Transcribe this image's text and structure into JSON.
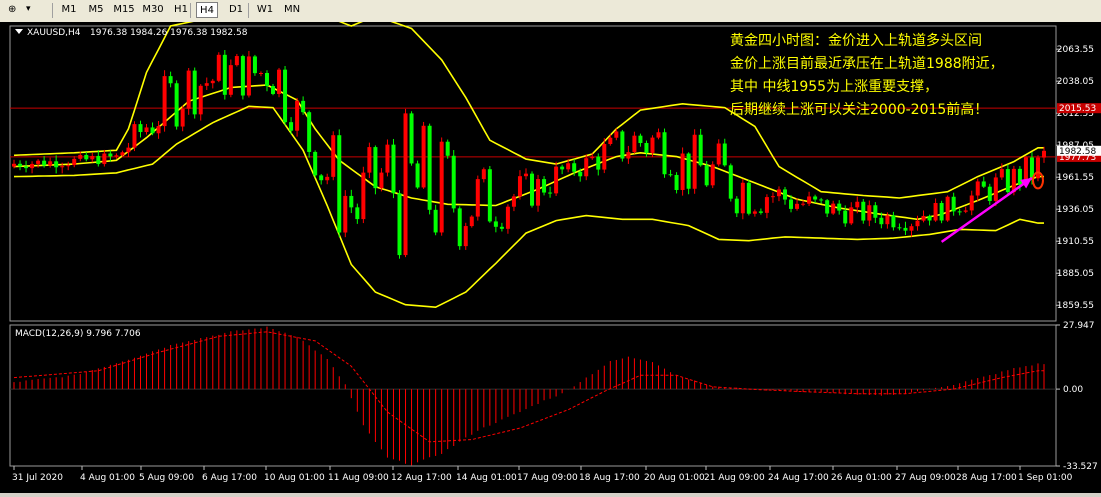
{
  "toolbar": {
    "timeframes": [
      "M1",
      "M5",
      "M15",
      "M30",
      "H1",
      "H4",
      "D1",
      "W1",
      "MN"
    ],
    "active": "H4"
  },
  "chart_data": {
    "type": "candlestick",
    "symbol_label": "XAUUSD,H4",
    "ohlc_label": "1976.38 1984.26 1976.38 1982.58",
    "price_axis": {
      "ylim": [
        1847,
        2082
      ],
      "ticks": [
        "2063.55",
        "2038.05",
        "2012.55",
        "1987.05",
        "1961.55",
        "1936.05",
        "1910.55",
        "1885.05",
        "1859.55"
      ]
    },
    "horizontal_lines": [
      {
        "price": 2016.53,
        "label": "2015.53",
        "color": "#c80000"
      },
      {
        "price": 1977.73,
        "label": "1977.73",
        "color": "#c80000"
      }
    ],
    "last_price": {
      "price": 1982.58,
      "label": "1982.58"
    },
    "time_labels": [
      "31 Jul 2020",
      "4 Aug 01:00",
      "5 Aug 09:00",
      "6 Aug 17:00",
      "10 Aug 01:00",
      "11 Aug 09:00",
      "12 Aug 17:00",
      "14 Aug 01:00",
      "17 Aug 09:00",
      "18 Aug 17:00",
      "20 Aug 01:00",
      "21 Aug 09:00",
      "24 Aug 17:00",
      "26 Aug 01:00",
      "27 Aug 09:00",
      "28 Aug 17:00",
      "1 Sep 01:00"
    ],
    "bar_count": 172,
    "bb_upper": [
      [
        0,
        1979
      ],
      [
        10,
        1981
      ],
      [
        17,
        1983
      ],
      [
        19,
        2000
      ],
      [
        22,
        2045
      ],
      [
        26,
        2082
      ],
      [
        32,
        2088
      ],
      [
        40,
        2093
      ],
      [
        50,
        2093
      ],
      [
        56,
        2082
      ],
      [
        60,
        2090
      ],
      [
        66,
        2080
      ],
      [
        71,
        2055
      ],
      [
        75,
        2025
      ],
      [
        79,
        1991
      ],
      [
        85,
        1976
      ],
      [
        90,
        1972
      ],
      [
        96,
        1980
      ],
      [
        100,
        2000
      ],
      [
        104,
        2015
      ],
      [
        111,
        2020
      ],
      [
        118,
        2017
      ],
      [
        123,
        2002
      ],
      [
        127,
        1970
      ],
      [
        134,
        1950
      ],
      [
        141,
        1947
      ],
      [
        147,
        1945
      ],
      [
        155,
        1950
      ],
      [
        160,
        1962
      ],
      [
        166,
        1974
      ],
      [
        170,
        1985
      ]
    ],
    "bb_middle": [
      [
        0,
        1970
      ],
      [
        10,
        1972
      ],
      [
        17,
        1975
      ],
      [
        22,
        1993
      ],
      [
        29,
        2022
      ],
      [
        36,
        2033
      ],
      [
        42,
        2035
      ],
      [
        47,
        2023
      ],
      [
        50,
        2000
      ],
      [
        54,
        1975
      ],
      [
        60,
        1954
      ],
      [
        66,
        1945
      ],
      [
        72,
        1940
      ],
      [
        80,
        1939
      ],
      [
        87,
        1952
      ],
      [
        93,
        1965
      ],
      [
        100,
        1978
      ],
      [
        104,
        1981
      ],
      [
        110,
        1978
      ],
      [
        116,
        1970
      ],
      [
        123,
        1957
      ],
      [
        130,
        1944
      ],
      [
        137,
        1937
      ],
      [
        144,
        1932
      ],
      [
        150,
        1928
      ],
      [
        154,
        1932
      ],
      [
        160,
        1943
      ],
      [
        166,
        1955
      ],
      [
        170,
        1962
      ]
    ],
    "bb_lower": [
      [
        0,
        1962
      ],
      [
        10,
        1963
      ],
      [
        17,
        1965
      ],
      [
        23,
        1972
      ],
      [
        27,
        1988
      ],
      [
        33,
        2005
      ],
      [
        39,
        2018
      ],
      [
        43,
        2017
      ],
      [
        48,
        1983
      ],
      [
        52,
        1939
      ],
      [
        56,
        1892
      ],
      [
        60,
        1870
      ],
      [
        65,
        1860
      ],
      [
        70,
        1858
      ],
      [
        75,
        1870
      ],
      [
        80,
        1893
      ],
      [
        85,
        1917
      ],
      [
        90,
        1927
      ],
      [
        95,
        1931
      ],
      [
        101,
        1928
      ],
      [
        106,
        1928
      ],
      [
        112,
        1923
      ],
      [
        117,
        1912
      ],
      [
        122,
        1911
      ],
      [
        128,
        1914
      ],
      [
        134,
        1913
      ],
      [
        140,
        1912
      ],
      [
        146,
        1913
      ],
      [
        152,
        1916
      ],
      [
        157,
        1920
      ],
      [
        163,
        1919
      ],
      [
        167,
        1928
      ],
      [
        170,
        1925
      ]
    ],
    "annotation": {
      "lines": [
        "黄金四小时图：金价进入上轨道多头区间",
        "金价上涨目前最近承压在上轨道1988附近，",
        "其中 中线1955为上涨重要支撑，",
        "后期继续上涨可以关注2000-2015前高！"
      ],
      "color": "#ffff00"
    },
    "arrow": {
      "from": [
        154,
        1910
      ],
      "to": [
        170,
        1961
      ],
      "color": "#ff00ff"
    },
    "circle_marker": {
      "x": 170,
      "price": 1959,
      "color": "#ff3300"
    },
    "macd": {
      "label": "MACD(12,26,9) 9.796 7.706",
      "ylim": [
        -33.527,
        27.947
      ],
      "ticks": [
        "27.947",
        "0.00",
        "-33.527"
      ],
      "histogram_points": [
        [
          0,
          3
        ],
        [
          10,
          6
        ],
        [
          19,
          13
        ],
        [
          27,
          20
        ],
        [
          36,
          25
        ],
        [
          42,
          27
        ],
        [
          47,
          23
        ],
        [
          52,
          13
        ],
        [
          55,
          2
        ],
        [
          58,
          -16
        ],
        [
          62,
          -30
        ],
        [
          66,
          -33
        ],
        [
          71,
          -28
        ],
        [
          77,
          -18
        ],
        [
          84,
          -10
        ],
        [
          88,
          -5
        ],
        [
          91,
          -2
        ],
        [
          95,
          5
        ],
        [
          99,
          12
        ],
        [
          102,
          14
        ],
        [
          106,
          12
        ],
        [
          110,
          6
        ],
        [
          116,
          1
        ],
        [
          122,
          0
        ],
        [
          130,
          -1
        ],
        [
          138,
          -2
        ],
        [
          144,
          -3
        ],
        [
          150,
          -1
        ],
        [
          156,
          2
        ],
        [
          162,
          6
        ],
        [
          166,
          9
        ],
        [
          170,
          11
        ]
      ],
      "signal_points": [
        [
          0,
          5
        ],
        [
          14,
          8
        ],
        [
          24,
          16
        ],
        [
          34,
          23
        ],
        [
          42,
          25
        ],
        [
          50,
          21
        ],
        [
          56,
          10
        ],
        [
          62,
          -10
        ],
        [
          69,
          -23
        ],
        [
          76,
          -22
        ],
        [
          84,
          -17
        ],
        [
          92,
          -9
        ],
        [
          98,
          -1
        ],
        [
          104,
          6
        ],
        [
          110,
          6
        ],
        [
          116,
          1
        ],
        [
          122,
          0
        ],
        [
          130,
          -1
        ],
        [
          140,
          -2
        ],
        [
          148,
          -2
        ],
        [
          156,
          0
        ],
        [
          164,
          5
        ],
        [
          170,
          8
        ]
      ]
    }
  }
}
